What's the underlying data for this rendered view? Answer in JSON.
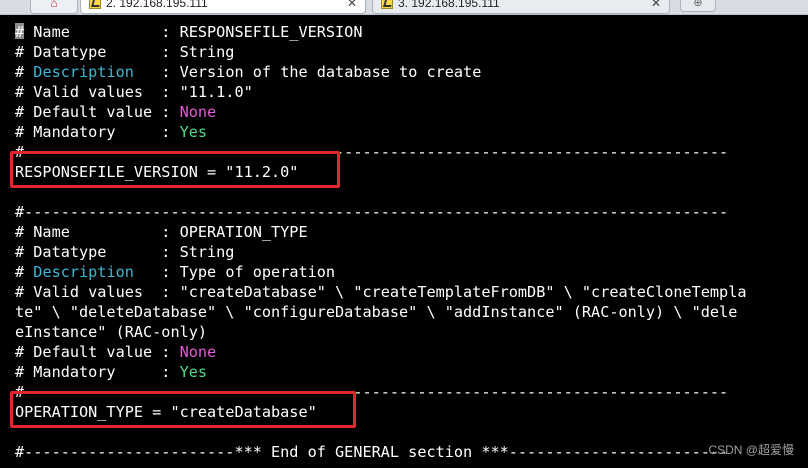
{
  "tabs": [
    {
      "label": "2. 192.168.195.111",
      "active": true
    },
    {
      "label": "3. 192.168.195.111",
      "active": false
    }
  ],
  "terminal": {
    "lines": [
      [
        "# Name          : RESPONSEFILE_VERSION"
      ],
      [
        "# Datatype      : String"
      ],
      [
        "# ",
        "Description",
        "   : Version of the database to create"
      ],
      [
        "# Valid values  : \"11.1.0\""
      ],
      [
        "# Default value : ",
        "None"
      ],
      [
        "# Mandatory     : ",
        "Yes"
      ],
      [
        "#-----------------------------------------------------------------------------"
      ],
      [
        "RESPONSEFILE_VERSION = \"11.2.0\""
      ],
      [
        ""
      ],
      [
        "#-----------------------------------------------------------------------------"
      ],
      [
        "# Name          : OPERATION_TYPE"
      ],
      [
        "# Datatype      : String"
      ],
      [
        "# ",
        "Description",
        "   : Type of operation"
      ],
      [
        "# Valid values  : \"createDatabase\" \\ \"createTemplateFromDB\" \\ \"createCloneTempla"
      ],
      [
        "te\" \\ \"deleteDatabase\" \\ \"configureDatabase\" \\ \"addInstance\" (RAC-only) \\ \"dele"
      ],
      [
        "eInstance\" (RAC-only)"
      ],
      [
        "# Default value : ",
        "None"
      ],
      [
        "# Mandatory     : ",
        "Yes"
      ],
      [
        "#-----------------------------------------------------------------------------"
      ],
      [
        "OPERATION_TYPE = \"createDatabase\""
      ],
      [
        ""
      ],
      [
        "#-----------------------*** End of GENERAL section ***------------------------"
      ]
    ],
    "colors": {
      "background": "#000000",
      "text": "#ffffff",
      "description": "#3fb6d4",
      "none_value": "#e35bd8",
      "yes_value": "#4fdc8a",
      "highlight": "#e3262b"
    }
  },
  "watermark": "CSDN @超爱慢"
}
